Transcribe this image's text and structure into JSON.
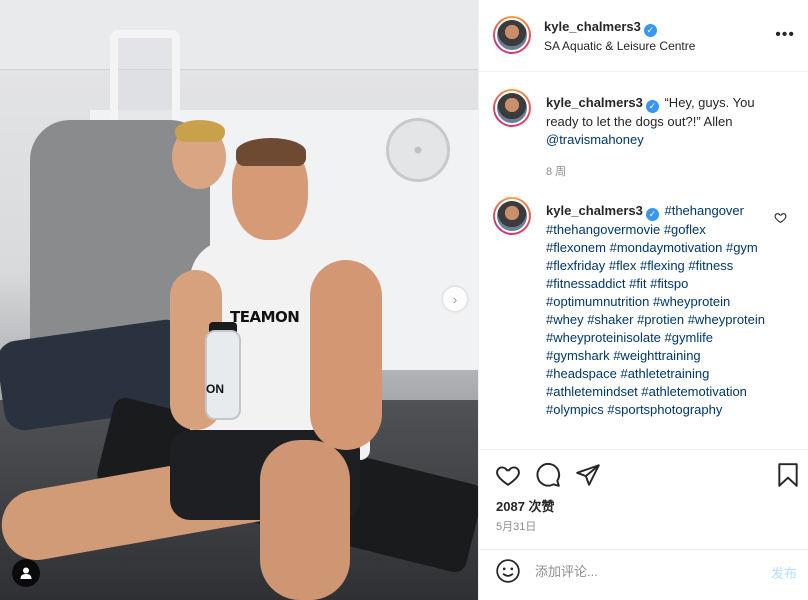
{
  "photo": {
    "shirt_logo": "TEAMON",
    "bottle_logo": "ON"
  },
  "header": {
    "username": "kyle_chalmers3",
    "verified_mark": "✓",
    "location": "SA Aquatic & Leisure Centre",
    "more_icon": "more-dots-icon"
  },
  "caption": {
    "username": "kyle_chalmers3",
    "text_before": " “Hey, guys. You ready to let the dogs out?!” Allen ",
    "mention": "@travismahoney",
    "time": "8 周"
  },
  "comment": {
    "username": "kyle_chalmers3",
    "hashtags": [
      "#thehangover",
      "#thehangovermovie",
      "#goflex",
      "#flexonem",
      "#mondaymotivation",
      "#gym",
      "#flexfriday",
      "#flex",
      "#flexing",
      "#fitness",
      "#fitnessaddict",
      "#fit",
      "#fitspo",
      "#optimumnutrition",
      "#wheyprotein",
      "#whey",
      "#shaker",
      "#protien",
      "#wheyprotein",
      "#wheyproteinisolate",
      "#gymlife",
      "#gymshark",
      "#weighttraining",
      "#headspace",
      "#athletetraining",
      "#athletemindset",
      "#athletemotivation",
      "#olympics",
      "#sportsphotography"
    ]
  },
  "actions": {
    "likes": "2087 次赞",
    "date": "5月31日"
  },
  "add_comment": {
    "placeholder": "添加评论...",
    "post_label": "发布"
  }
}
